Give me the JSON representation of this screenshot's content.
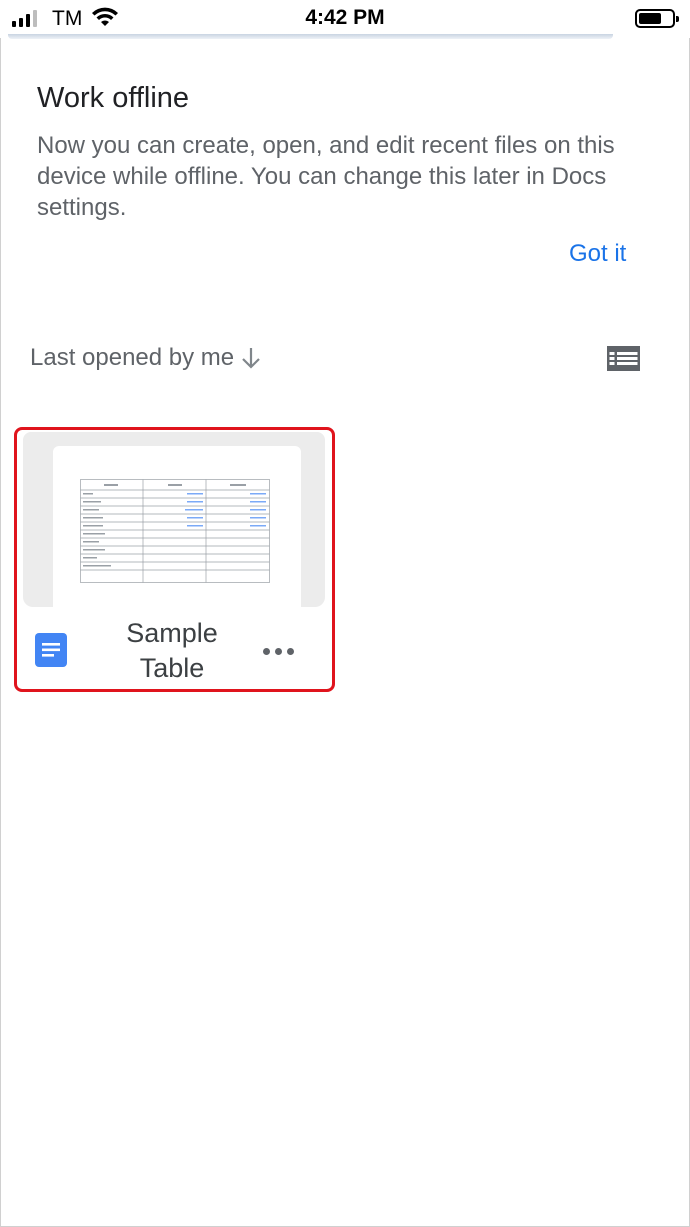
{
  "status_bar": {
    "carrier": "TM",
    "time": "4:42 PM"
  },
  "offline_banner": {
    "title": "Work offline",
    "description": "Now you can create, open, and edit recent files on this device while offline. You can change this later in Docs settings.",
    "got_it_label": "Got it"
  },
  "sort": {
    "label": "Last opened by me",
    "direction_icon": "arrow-down-icon",
    "view_toggle_icon": "list-view-icon"
  },
  "files": [
    {
      "name": "Sample Table",
      "type_icon": "google-docs-icon",
      "menu_icon": "more-horizontal-icon"
    }
  ],
  "colors": {
    "accent": "#1a73e8",
    "highlight_border": "#e0141d",
    "docs_blue": "#4285f4"
  }
}
